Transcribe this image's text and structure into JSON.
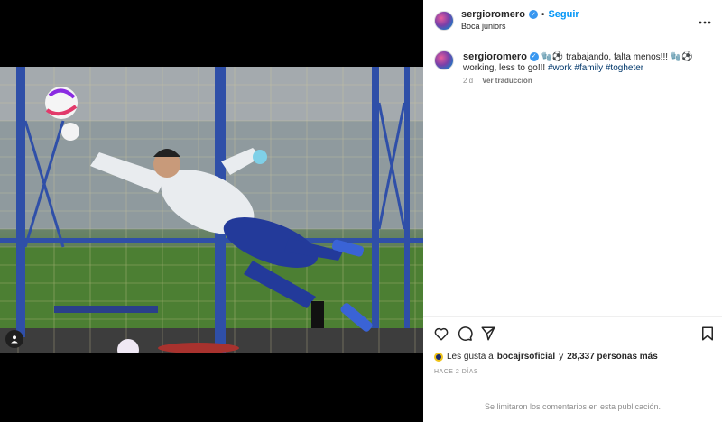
{
  "post": {
    "username": "sergioromero",
    "follow_label": "Seguir",
    "separator": "•",
    "location": "Boca juniors",
    "more_icon": "more-horizontal-icon",
    "caption": {
      "emojis_lead": "🧤⚽",
      "text_line1": "trabajando, falta menos!!!",
      "emojis_trail": "🧤⚽",
      "text_line2": "working, less to go!!!",
      "hashtags": [
        "#work",
        "#family",
        "#togheter"
      ]
    },
    "caption_time": "2 d",
    "translate_label": "Ver traducción",
    "likes": {
      "prefix": "Les gusta a",
      "first_user": "bocajrsoficial",
      "connector": "y",
      "others": "28,337 personas más"
    },
    "time_ago": "HACE 2 DÍAS",
    "comments_disabled": "Se limitaron los comentarios en esta publicación."
  },
  "icons": {
    "like": "heart-icon",
    "comment": "comment-icon",
    "share": "paper-plane-icon",
    "save": "bookmark-icon",
    "tagged_user": "user-tag-icon",
    "verified": "verified-badge-icon"
  },
  "colors": {
    "link_blue": "#0095f6",
    "verified_blue": "#3897f0",
    "hashtag_blue": "#00376b",
    "muted": "#8e8e8e"
  }
}
